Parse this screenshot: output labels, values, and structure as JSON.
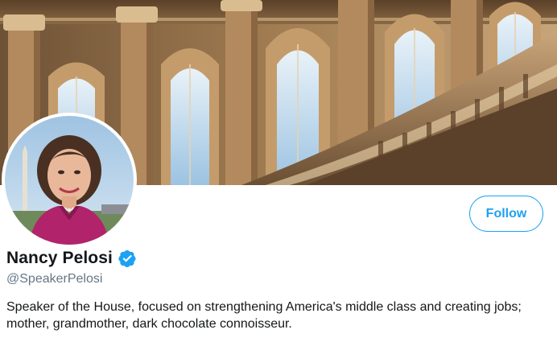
{
  "profile": {
    "display_name": "Nancy Pelosi",
    "handle": "@SpeakerPelosi",
    "bio": "Speaker of the House, focused on strengthening America's middle class and creating jobs; mother, grandmother, dark chocolate connoisseur.",
    "verified": true,
    "follow_label": "Follow"
  },
  "colors": {
    "accent": "#1da1f2",
    "name_text": "#14171a",
    "secondary_text": "#657786"
  },
  "icons": {
    "verified": "verified-badge-icon"
  }
}
